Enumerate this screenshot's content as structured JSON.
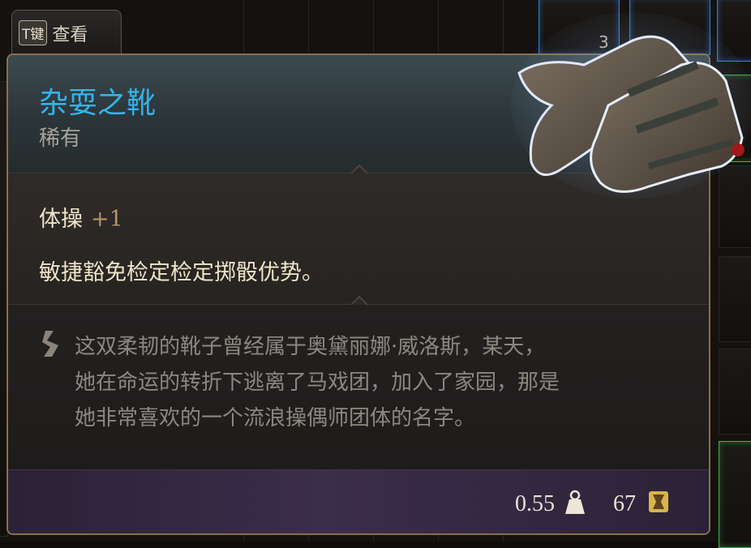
{
  "key_tab": {
    "key": "T键",
    "label": "查看"
  },
  "item": {
    "name": "杂耍之靴",
    "rarity": "稀有",
    "stat_name": "体操",
    "stat_value": "+1",
    "effect": "敏捷豁免检定检定掷骰优势。",
    "lore_lines": [
      "这双柔韧的靴子曾经属于奥黛丽娜·威洛斯，某天，",
      "她在命运的转折下逃离了马戏团，加入了家园，那是",
      "她非常喜欢的一个流浪操偶师团体的名字。"
    ],
    "weight": "0.55",
    "price": "67"
  },
  "inventory": {
    "stack_count": "3"
  },
  "colors": {
    "title": "#35b3ea",
    "stat_value": "#b5936a",
    "panel_border": "#8a6f4f",
    "footer": "#3b2d4c"
  },
  "icons": {
    "quote": "quote-icon",
    "weight": "weight-icon",
    "price": "gold-coin-icon",
    "item": "boots-icon"
  }
}
